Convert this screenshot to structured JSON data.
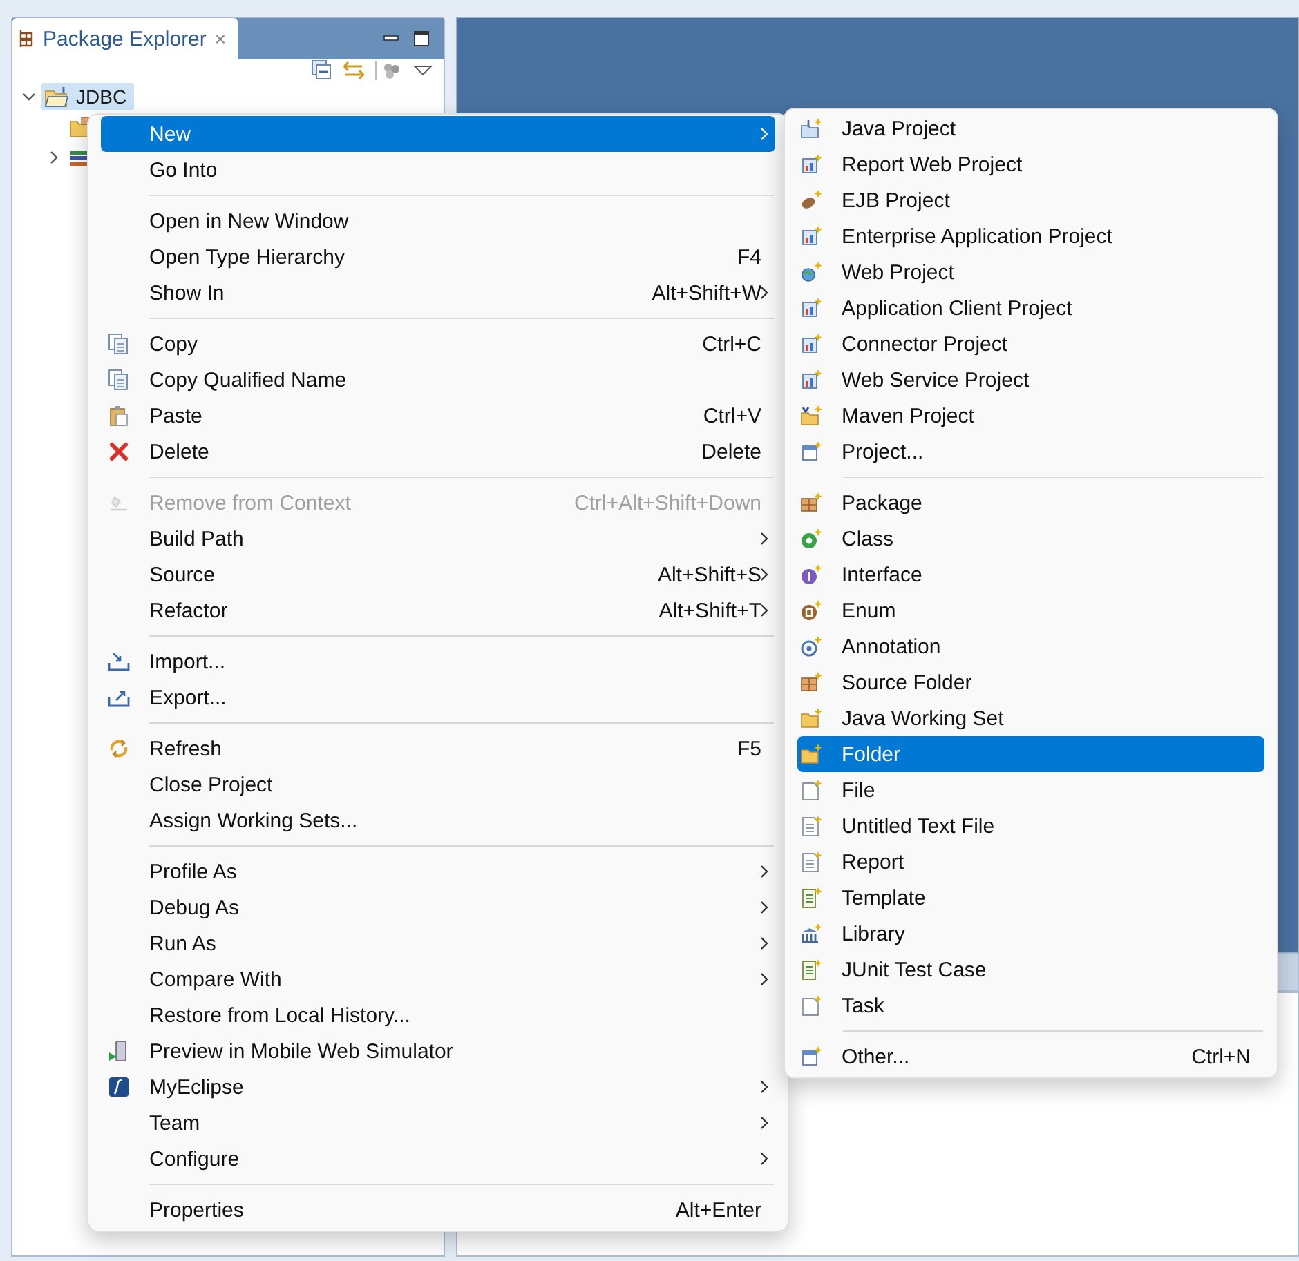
{
  "package_explorer": {
    "tab": {
      "label": "Package Explorer",
      "close": "×"
    },
    "tree": [
      {
        "label": "JDBC",
        "kind": "project",
        "expanded": true,
        "selected": true,
        "children": [
          {
            "kind": "folder",
            "selected": false
          },
          {
            "kind": "library",
            "expanded": false,
            "selected": false
          }
        ]
      }
    ]
  },
  "context_menu": {
    "items": [
      {
        "kind": "item",
        "label": "New",
        "submenu": true,
        "selected": true
      },
      {
        "kind": "item",
        "label": "Go Into",
        "selected": false
      },
      {
        "kind": "separator"
      },
      {
        "kind": "item",
        "label": "Open in New Window",
        "selected": false
      },
      {
        "kind": "item",
        "label": "Open Type Hierarchy",
        "shortcut": "F4",
        "selected": false
      },
      {
        "kind": "item",
        "label": "Show In",
        "shortcut": "Alt+Shift+W",
        "submenu": true,
        "selected": false
      },
      {
        "kind": "separator"
      },
      {
        "kind": "item",
        "label": "Copy",
        "shortcut": "Ctrl+C",
        "selected": false
      },
      {
        "kind": "item",
        "label": "Copy Qualified Name",
        "selected": false
      },
      {
        "kind": "item",
        "label": "Paste",
        "shortcut": "Ctrl+V",
        "selected": false
      },
      {
        "kind": "item",
        "label": "Delete",
        "shortcut": "Delete",
        "selected": false
      },
      {
        "kind": "separator"
      },
      {
        "kind": "item",
        "label": "Remove from Context",
        "shortcut": "Ctrl+Alt+Shift+Down",
        "disabled": true,
        "selected": false
      },
      {
        "kind": "item",
        "label": "Build Path",
        "submenu": true,
        "selected": false
      },
      {
        "kind": "item",
        "label": "Source",
        "shortcut": "Alt+Shift+S",
        "submenu": true,
        "selected": false
      },
      {
        "kind": "item",
        "label": "Refactor",
        "shortcut": "Alt+Shift+T",
        "submenu": true,
        "selected": false
      },
      {
        "kind": "separator"
      },
      {
        "kind": "item",
        "label": "Import...",
        "selected": false
      },
      {
        "kind": "item",
        "label": "Export...",
        "selected": false
      },
      {
        "kind": "separator"
      },
      {
        "kind": "item",
        "label": "Refresh",
        "shortcut": "F5",
        "selected": false
      },
      {
        "kind": "item",
        "label": "Close Project",
        "selected": false
      },
      {
        "kind": "item",
        "label": "Assign Working Sets...",
        "selected": false
      },
      {
        "kind": "separator"
      },
      {
        "kind": "item",
        "label": "Profile As",
        "submenu": true,
        "selected": false
      },
      {
        "kind": "item",
        "label": "Debug As",
        "submenu": true,
        "selected": false
      },
      {
        "kind": "item",
        "label": "Run As",
        "submenu": true,
        "selected": false
      },
      {
        "kind": "item",
        "label": "Compare With",
        "submenu": true,
        "selected": false
      },
      {
        "kind": "item",
        "label": "Restore from Local History...",
        "selected": false
      },
      {
        "kind": "item",
        "label": "Preview in Mobile Web Simulator",
        "selected": false
      },
      {
        "kind": "item",
        "label": "MyEclipse",
        "submenu": true,
        "selected": false
      },
      {
        "kind": "item",
        "label": "Team",
        "submenu": true,
        "selected": false
      },
      {
        "kind": "item",
        "label": "Configure",
        "submenu": true,
        "selected": false
      },
      {
        "kind": "separator"
      },
      {
        "kind": "item",
        "label": "Properties",
        "shortcut": "Alt+Enter",
        "selected": false
      }
    ]
  },
  "new_submenu": {
    "items": [
      {
        "kind": "item",
        "label": "Java Project",
        "selected": false
      },
      {
        "kind": "item",
        "label": "Report Web Project",
        "selected": false
      },
      {
        "kind": "item",
        "label": "EJB Project",
        "selected": false
      },
      {
        "kind": "item",
        "label": "Enterprise Application Project",
        "selected": false
      },
      {
        "kind": "item",
        "label": "Web Project",
        "selected": false
      },
      {
        "kind": "item",
        "label": "Application Client Project",
        "selected": false
      },
      {
        "kind": "item",
        "label": "Connector Project",
        "selected": false
      },
      {
        "kind": "item",
        "label": "Web Service Project",
        "selected": false
      },
      {
        "kind": "item",
        "label": "Maven Project",
        "selected": false
      },
      {
        "kind": "item",
        "label": "Project...",
        "selected": false
      },
      {
        "kind": "separator"
      },
      {
        "kind": "item",
        "label": "Package",
        "selected": false
      },
      {
        "kind": "item",
        "label": "Class",
        "selected": false
      },
      {
        "kind": "item",
        "label": "Interface",
        "selected": false
      },
      {
        "kind": "item",
        "label": "Enum",
        "selected": false
      },
      {
        "kind": "item",
        "label": "Annotation",
        "selected": false
      },
      {
        "kind": "item",
        "label": "Source Folder",
        "selected": false
      },
      {
        "kind": "item",
        "label": "Java Working Set",
        "selected": false
      },
      {
        "kind": "item",
        "label": "Folder",
        "selected": true
      },
      {
        "kind": "item",
        "label": "File",
        "selected": false
      },
      {
        "kind": "item",
        "label": "Untitled Text File",
        "selected": false
      },
      {
        "kind": "item",
        "label": "Report",
        "selected": false
      },
      {
        "kind": "item",
        "label": "Template",
        "selected": false
      },
      {
        "kind": "item",
        "label": "Library",
        "selected": false
      },
      {
        "kind": "item",
        "label": "JUnit Test Case",
        "selected": false
      },
      {
        "kind": "item",
        "label": "Task",
        "selected": false
      },
      {
        "kind": "separator"
      },
      {
        "kind": "item",
        "label": "Other...",
        "shortcut": "Ctrl+N",
        "selected": false
      }
    ]
  }
}
